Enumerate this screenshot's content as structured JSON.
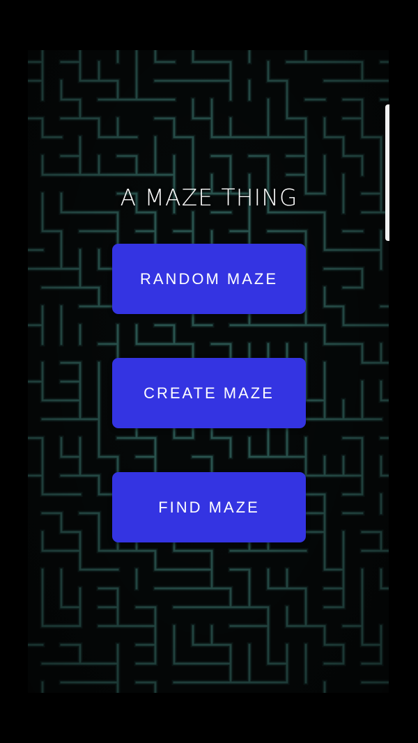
{
  "app": {
    "title": "A MAZE THING"
  },
  "menu": {
    "random_label": "RANDOM MAZE",
    "create_label": "CREATE MAZE",
    "find_label": "FIND MAZE"
  },
  "colors": {
    "button": "#3434e2",
    "maze_line": "#2f5c57",
    "background": "#000000"
  }
}
